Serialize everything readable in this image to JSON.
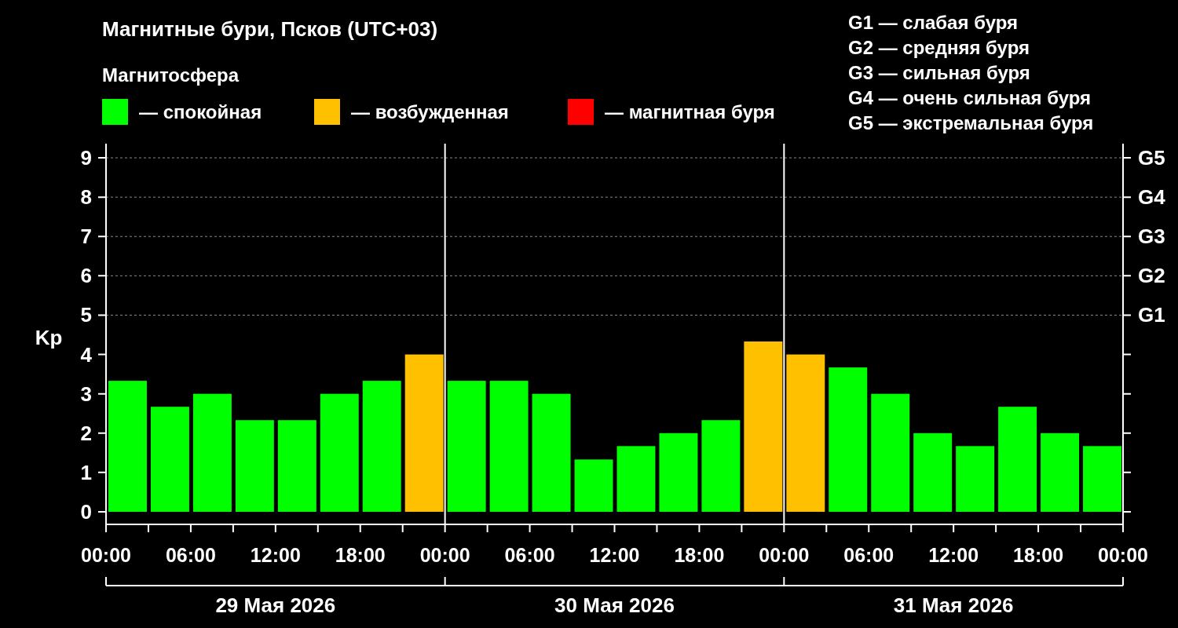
{
  "title": "Магнитные бури, Псков (UTC+03)",
  "legend": {
    "heading": "Магнитосфера",
    "items": [
      {
        "label": "— спокойная",
        "color": "#00ff00"
      },
      {
        "label": "— возбужденная",
        "color": "#ffc000"
      },
      {
        "label": "— магнитная буря",
        "color": "#ff0000"
      }
    ]
  },
  "scale": [
    "G1 — слабая буря",
    "G2 — средняя буря",
    "G3 — сильная буря",
    "G4 — очень сильная буря",
    "G5 — экстремальная буря"
  ],
  "chart": {
    "chart_data": {
      "type": "bar",
      "ylabel": "Kp",
      "stacked": true,
      "x": [
        "2026-05-29T01:30",
        "2026-05-29T04:30",
        "2026-05-29T07:30",
        "2026-05-29T10:30",
        "2026-05-29T13:30",
        "2026-05-29T16:30",
        "2026-05-29T19:30",
        "2026-05-29T22:30",
        "2026-05-30T01:30",
        "2026-05-30T04:30",
        "2026-05-30T07:30",
        "2026-05-30T10:30",
        "2026-05-30T13:30",
        "2026-05-30T16:30",
        "2026-05-30T19:30",
        "2026-05-30T22:30",
        "2026-05-31T01:30",
        "2026-05-31T04:30",
        "2026-05-31T07:30",
        "2026-05-31T10:30",
        "2026-05-31T13:30",
        "2026-05-31T16:30",
        "2026-05-31T19:30",
        "2026-05-31T22:30"
      ],
      "series": [
        {
          "color": "#00ff00",
          "values": [
            3.33,
            2.67,
            3,
            2.33,
            2.33,
            3,
            3.33,
            null,
            3.33,
            3.33,
            3,
            1.33,
            1.67,
            2,
            2.33,
            null,
            null,
            3.67,
            3,
            2,
            1.67,
            2.67,
            2,
            1.67
          ]
        },
        {
          "color": "#ffc000",
          "values": [
            null,
            null,
            null,
            null,
            null,
            null,
            null,
            4,
            null,
            null,
            null,
            null,
            null,
            null,
            null,
            4.33,
            4,
            null,
            null,
            null,
            null,
            null,
            null,
            null
          ]
        }
      ],
      "xlim": [
        "2026-05-29T00:00",
        "2026-06-01T00:00"
      ],
      "ylim": [
        -0.32,
        9.36
      ],
      "grid": true,
      "xticks": [
        {
          "value": "2026-05-29T00:00",
          "label": "00:00"
        },
        {
          "value": "2026-05-29T06:00",
          "label": "06:00"
        },
        {
          "value": "2026-05-29T12:00",
          "label": "12:00"
        },
        {
          "value": "2026-05-29T18:00",
          "label": "18:00"
        },
        {
          "value": "2026-05-30T00:00",
          "label": "00:00"
        },
        {
          "value": "2026-05-30T06:00",
          "label": "06:00"
        },
        {
          "value": "2026-05-30T12:00",
          "label": "12:00"
        },
        {
          "value": "2026-05-30T18:00",
          "label": "18:00"
        },
        {
          "value": "2026-05-31T00:00",
          "label": "00:00"
        },
        {
          "value": "2026-05-31T06:00",
          "label": "06:00"
        },
        {
          "value": "2026-05-31T12:00",
          "label": "12:00"
        },
        {
          "value": "2026-05-31T18:00",
          "label": "18:00"
        },
        {
          "value": "2026-06-01T00:00",
          "label": "00:00"
        }
      ],
      "yticks": [
        0,
        1,
        2,
        3,
        4,
        5,
        6,
        7,
        8,
        9
      ]
    },
    "g_levels": [
      "G5",
      "G4",
      "G3",
      "G2",
      "G1"
    ],
    "dates": [
      "29 Мая 2026",
      "30 Мая 2026",
      "31 Мая 2026"
    ]
  }
}
